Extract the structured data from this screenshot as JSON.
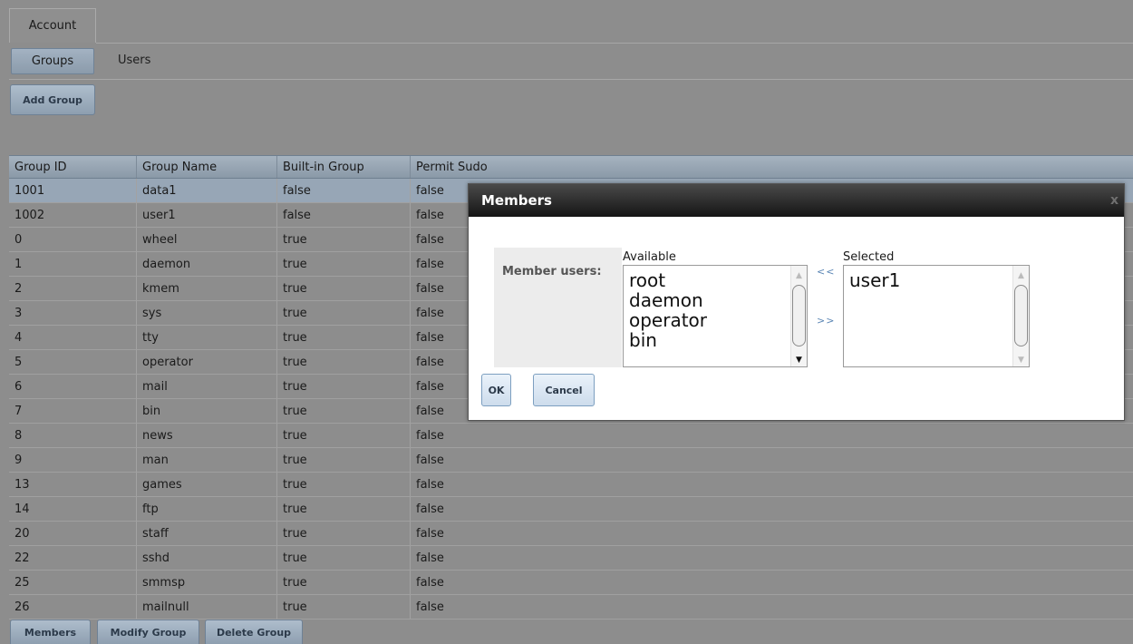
{
  "tabs": {
    "account": "Account"
  },
  "subtabs": {
    "groups": "Groups",
    "users": "Users"
  },
  "toolbar": {
    "add_group": "Add Group"
  },
  "grid": {
    "columns": [
      "Group ID",
      "Group Name",
      "Built-in Group",
      "Permit Sudo"
    ],
    "rows": [
      [
        "1001",
        "data1",
        "false",
        "false"
      ],
      [
        "1002",
        "user1",
        "false",
        "false"
      ],
      [
        "0",
        "wheel",
        "true",
        "false"
      ],
      [
        "1",
        "daemon",
        "true",
        "false"
      ],
      [
        "2",
        "kmem",
        "true",
        "false"
      ],
      [
        "3",
        "sys",
        "true",
        "false"
      ],
      [
        "4",
        "tty",
        "true",
        "false"
      ],
      [
        "5",
        "operator",
        "true",
        "false"
      ],
      [
        "6",
        "mail",
        "true",
        "false"
      ],
      [
        "7",
        "bin",
        "true",
        "false"
      ],
      [
        "8",
        "news",
        "true",
        "false"
      ],
      [
        "9",
        "man",
        "true",
        "false"
      ],
      [
        "13",
        "games",
        "true",
        "false"
      ],
      [
        "14",
        "ftp",
        "true",
        "false"
      ],
      [
        "20",
        "staff",
        "true",
        "false"
      ],
      [
        "22",
        "sshd",
        "true",
        "false"
      ],
      [
        "25",
        "smmsp",
        "true",
        "false"
      ],
      [
        "26",
        "mailnull",
        "true",
        "false"
      ]
    ]
  },
  "bottom_buttons": {
    "members": "Members",
    "modify": "Modify Group",
    "delete": "Delete Group"
  },
  "dialog": {
    "title": "Members",
    "close": "x",
    "member_users_label": "Member users:",
    "available_label": "Available",
    "selected_label": "Selected",
    "available": [
      "root",
      "daemon",
      "operator",
      "bin"
    ],
    "selected": [
      "user1"
    ],
    "move_left": "<<",
    "move_right": ">>",
    "ok": "OK",
    "cancel": "Cancel"
  }
}
